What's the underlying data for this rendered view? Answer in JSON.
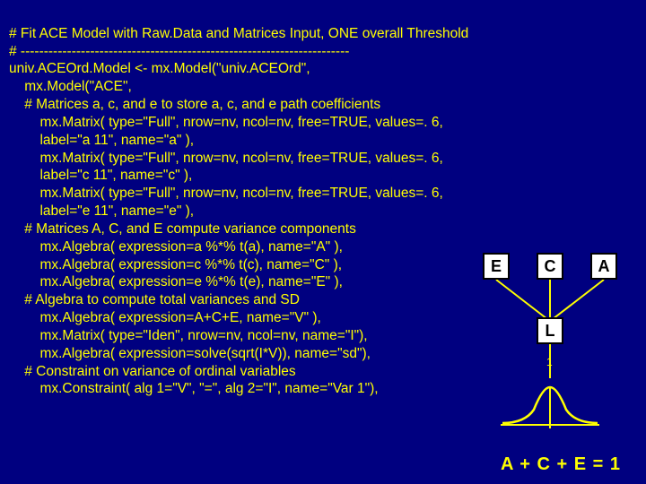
{
  "code": {
    "l1": "# Fit ACE Model with Raw.Data and Matrices Input, ONE overall Threshold",
    "l2": "# -----------------------------------------------------------------------",
    "l3": "univ.ACEOrd.Model <- mx.Model(\"univ.ACEOrd\",",
    "l4": "    mx.Model(\"ACE\",",
    "l5": "    # Matrices a, c, and e to store a, c, and e path coefficients",
    "l6": "        mx.Matrix( type=\"Full\", nrow=nv, ncol=nv, free=TRUE, values=. 6,",
    "l7": "        label=\"a 11\", name=\"a\" ),",
    "l8": "        mx.Matrix( type=\"Full\", nrow=nv, ncol=nv, free=TRUE, values=. 6,",
    "l9": "        label=\"c 11\", name=\"c\" ),",
    "l10": "        mx.Matrix( type=\"Full\", nrow=nv, ncol=nv, free=TRUE, values=. 6,",
    "l11": "        label=\"e 11\", name=\"e\" ),",
    "l12": "    # Matrices A, C, and E compute variance components",
    "l13": "        mx.Algebra( expression=a %*% t(a), name=\"A\" ),",
    "l14": "        mx.Algebra( expression=c %*% t(c), name=\"C\" ),",
    "l15": "        mx.Algebra( expression=e %*% t(e), name=\"E\" ),",
    "l16": "    # Algebra to compute total variances and SD",
    "l17": "        mx.Algebra( expression=A+C+E, name=\"V\" ),",
    "l18": "        mx.Matrix( type=\"Iden\", nrow=nv, ncol=nv, name=\"I\"),",
    "l19": "        mx.Algebra( expression=solve(sqrt(I*V)), name=\"sd\"),",
    "l20": "    # Constraint on variance of ordinal variables",
    "l21": "        mx.Constraint( alg 1=\"V\", \"=\", alg 2=\"I\", name=\"Var 1\"),"
  },
  "diagram": {
    "E": "E",
    "C": "C",
    "A": "A",
    "L": "L",
    "one": "1",
    "formula": "A + C + E = 1"
  }
}
